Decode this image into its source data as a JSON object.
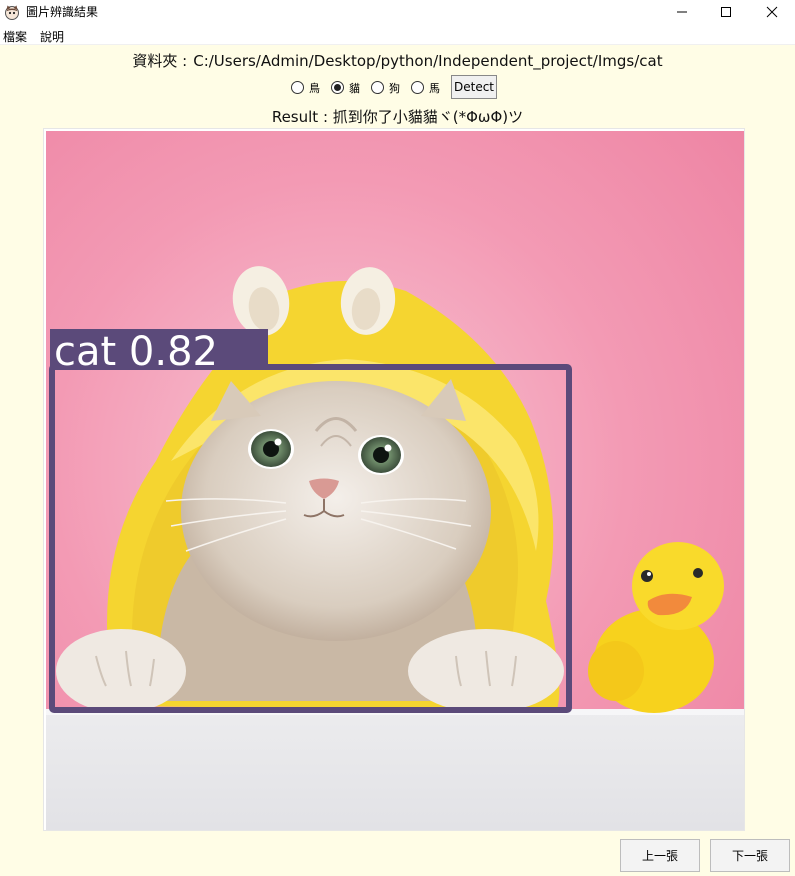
{
  "window": {
    "title": "圖片辨識結果",
    "app_icon": "cat-face-icon",
    "controls": [
      "minimize-icon",
      "maximize-icon",
      "close-icon"
    ]
  },
  "menu": {
    "file": "檔案",
    "help": "說明"
  },
  "folder": {
    "label": "資料夾 :",
    "path": "C:/Users/Admin/Desktop/python/Independent_project/Imgs/cat"
  },
  "classes": {
    "options": [
      {
        "label": "鳥",
        "selected": false
      },
      {
        "label": "貓",
        "selected": true
      },
      {
        "label": "狗",
        "selected": false
      },
      {
        "label": "馬",
        "selected": false
      }
    ],
    "detect_label": "Detect"
  },
  "result": {
    "text": "Result : 抓到你了小貓貓ヾ(*ΦωΦ)ツ"
  },
  "detection": {
    "label": "cat 0.82",
    "box_color": "#5b4a7a"
  },
  "navigation": {
    "prev_label": "上一張",
    "next_label": "下一張"
  },
  "colors": {
    "background": "#fffde6",
    "backdrop_pink": "#f088a6",
    "hoodie_yellow": "#f7dc3a"
  }
}
